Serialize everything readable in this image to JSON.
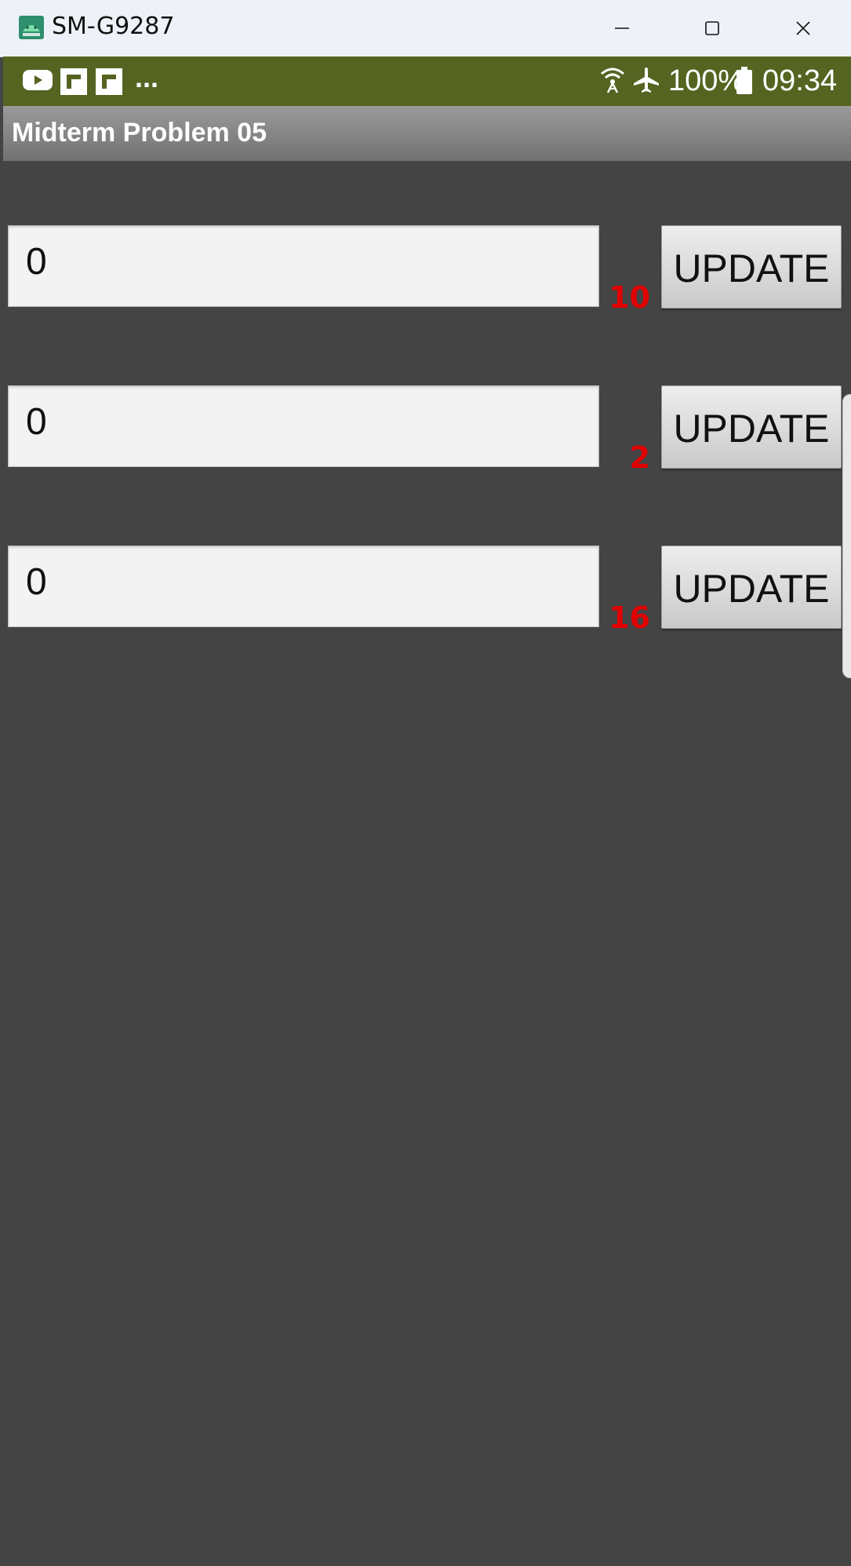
{
  "window": {
    "title": "SM-G9287",
    "icons": {
      "app": "android-icon",
      "minimize": "minimize-icon",
      "maximize": "maximize-icon",
      "close": "close-icon"
    }
  },
  "status_bar": {
    "notification_icons": [
      "youtube-icon",
      "flipboard-icon",
      "flipboard-icon"
    ],
    "more": "...",
    "battery_text": "100%",
    "time": "09:34",
    "colors": {
      "background": "#556421"
    }
  },
  "action_bar": {
    "title": "Midterm Problem 05"
  },
  "rows": [
    {
      "value": "0",
      "count": "10",
      "button_label": "UPDATE"
    },
    {
      "value": "0",
      "count": "2",
      "button_label": "UPDATE"
    },
    {
      "value": "0",
      "count": "16",
      "button_label": "UPDATE"
    }
  ],
  "colors": {
    "content_background": "#444444",
    "count_text": "#e00000"
  }
}
